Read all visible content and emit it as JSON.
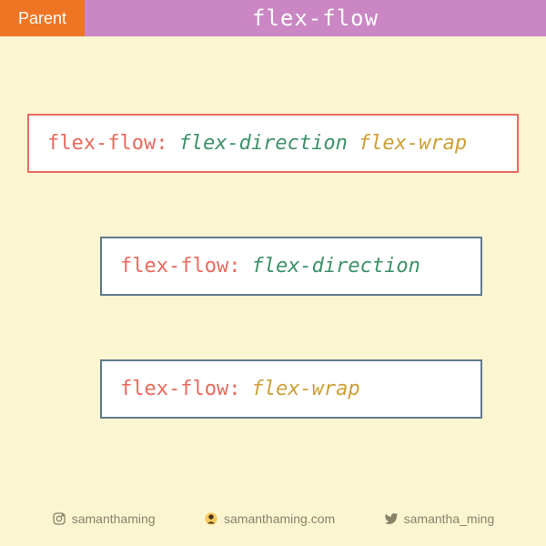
{
  "header": {
    "badge": "Parent",
    "title": "flex-flow"
  },
  "boxes": [
    {
      "property": "flex-flow:",
      "val1": "flex-direction",
      "val2": "flex-wrap"
    },
    {
      "property": "flex-flow:",
      "val1": "flex-direction",
      "val2": ""
    },
    {
      "property": "flex-flow:",
      "val1": "",
      "val2": "flex-wrap"
    }
  ],
  "footer": {
    "instagram": "samanthaming",
    "website": "samanthaming.com",
    "twitter": "samantha_ming"
  }
}
